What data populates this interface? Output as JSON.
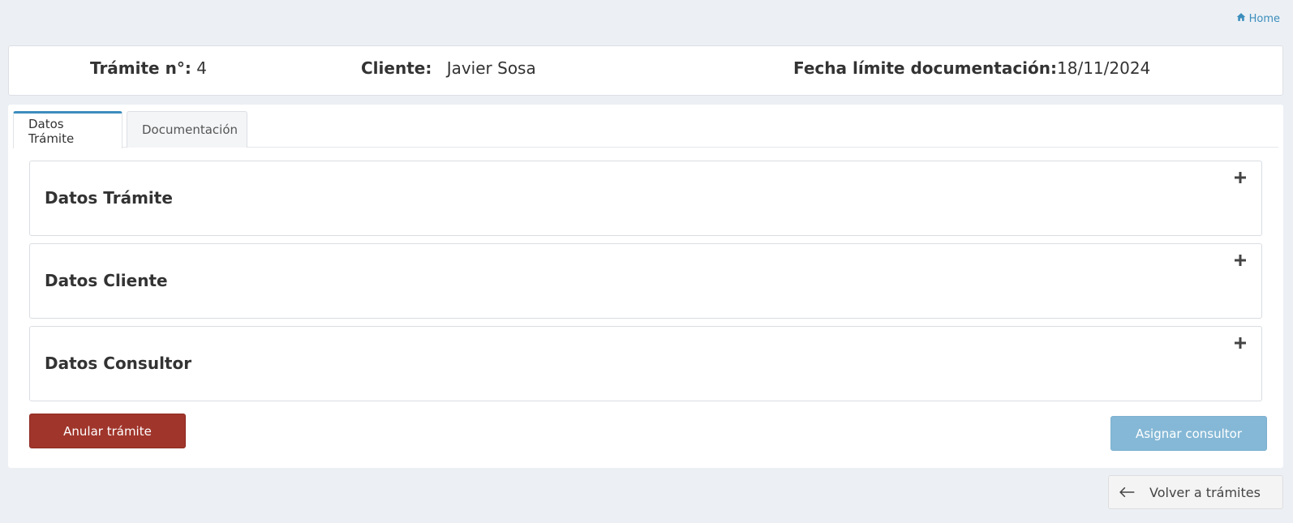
{
  "breadcrumb": {
    "home_label": "Home"
  },
  "info": {
    "tramite_label": "Trámite n°:",
    "tramite_value": "4",
    "cliente_label": "Cliente:",
    "cliente_value": "Javier Sosa",
    "fecha_label": "Fecha límite documentación:",
    "fecha_value": "18/11/2024"
  },
  "tabs": [
    {
      "label": "Datos Trámite",
      "active": true
    },
    {
      "label": "Documentación",
      "active": false
    }
  ],
  "panels": [
    {
      "title": "Datos Trámite",
      "toggle_icon": "plus-icon"
    },
    {
      "title": "Datos Cliente",
      "toggle_icon": "plus-icon"
    },
    {
      "title": "Datos Consultor",
      "toggle_icon": "plus-icon"
    }
  ],
  "actions": {
    "anular_label": "Anular trámite",
    "asignar_label": "Asignar consultor",
    "volver_label": "Volver a trámites"
  },
  "colors": {
    "accent": "#3c8dbc",
    "danger": "#a0352b",
    "disabled_primary": "#85b8d6",
    "background": "#ecf0f5"
  }
}
